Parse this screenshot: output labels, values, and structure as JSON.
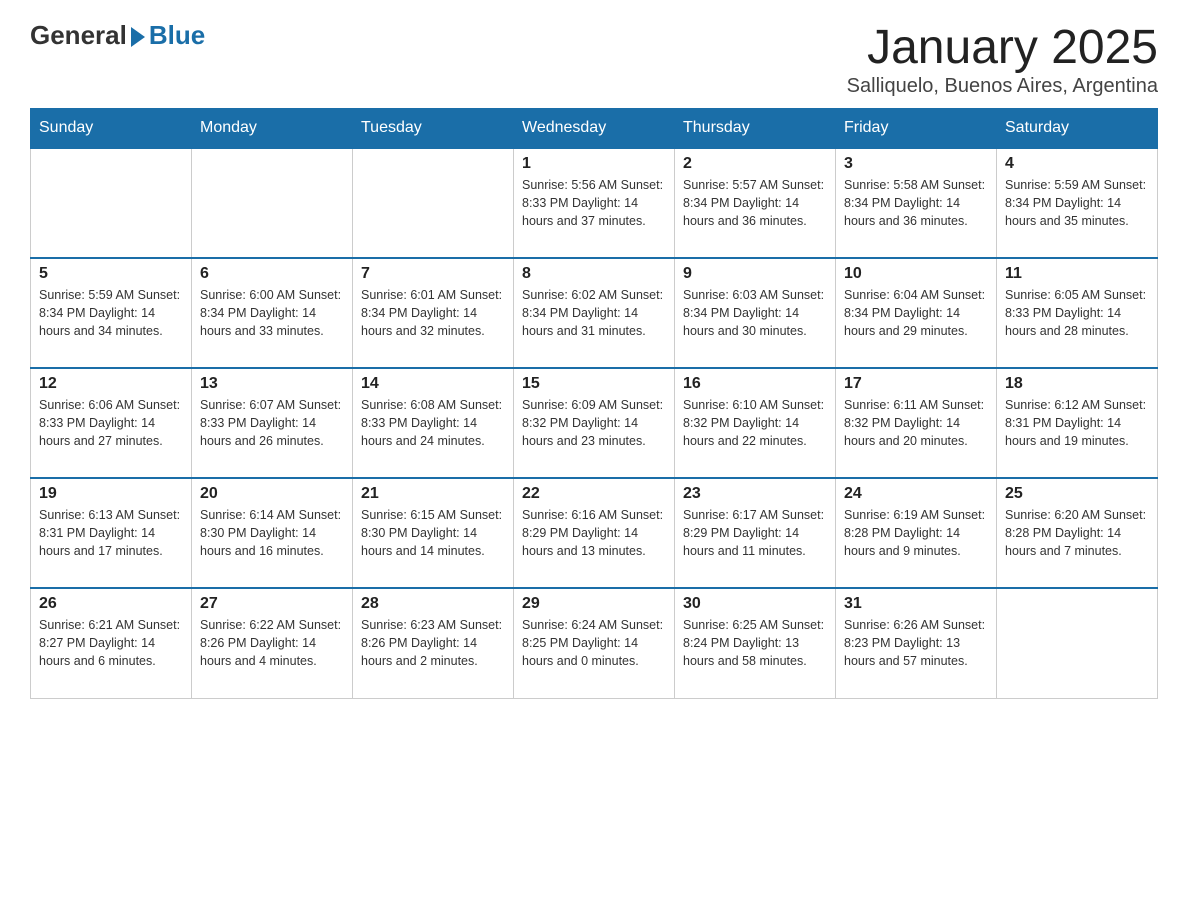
{
  "header": {
    "logo_general": "General",
    "logo_blue": "Blue",
    "title": "January 2025",
    "subtitle": "Salliquelo, Buenos Aires, Argentina"
  },
  "days_of_week": [
    "Sunday",
    "Monday",
    "Tuesday",
    "Wednesday",
    "Thursday",
    "Friday",
    "Saturday"
  ],
  "weeks": [
    [
      {
        "day": "",
        "info": ""
      },
      {
        "day": "",
        "info": ""
      },
      {
        "day": "",
        "info": ""
      },
      {
        "day": "1",
        "info": "Sunrise: 5:56 AM\nSunset: 8:33 PM\nDaylight: 14 hours and 37 minutes."
      },
      {
        "day": "2",
        "info": "Sunrise: 5:57 AM\nSunset: 8:34 PM\nDaylight: 14 hours and 36 minutes."
      },
      {
        "day": "3",
        "info": "Sunrise: 5:58 AM\nSunset: 8:34 PM\nDaylight: 14 hours and 36 minutes."
      },
      {
        "day": "4",
        "info": "Sunrise: 5:59 AM\nSunset: 8:34 PM\nDaylight: 14 hours and 35 minutes."
      }
    ],
    [
      {
        "day": "5",
        "info": "Sunrise: 5:59 AM\nSunset: 8:34 PM\nDaylight: 14 hours and 34 minutes."
      },
      {
        "day": "6",
        "info": "Sunrise: 6:00 AM\nSunset: 8:34 PM\nDaylight: 14 hours and 33 minutes."
      },
      {
        "day": "7",
        "info": "Sunrise: 6:01 AM\nSunset: 8:34 PM\nDaylight: 14 hours and 32 minutes."
      },
      {
        "day": "8",
        "info": "Sunrise: 6:02 AM\nSunset: 8:34 PM\nDaylight: 14 hours and 31 minutes."
      },
      {
        "day": "9",
        "info": "Sunrise: 6:03 AM\nSunset: 8:34 PM\nDaylight: 14 hours and 30 minutes."
      },
      {
        "day": "10",
        "info": "Sunrise: 6:04 AM\nSunset: 8:34 PM\nDaylight: 14 hours and 29 minutes."
      },
      {
        "day": "11",
        "info": "Sunrise: 6:05 AM\nSunset: 8:33 PM\nDaylight: 14 hours and 28 minutes."
      }
    ],
    [
      {
        "day": "12",
        "info": "Sunrise: 6:06 AM\nSunset: 8:33 PM\nDaylight: 14 hours and 27 minutes."
      },
      {
        "day": "13",
        "info": "Sunrise: 6:07 AM\nSunset: 8:33 PM\nDaylight: 14 hours and 26 minutes."
      },
      {
        "day": "14",
        "info": "Sunrise: 6:08 AM\nSunset: 8:33 PM\nDaylight: 14 hours and 24 minutes."
      },
      {
        "day": "15",
        "info": "Sunrise: 6:09 AM\nSunset: 8:32 PM\nDaylight: 14 hours and 23 minutes."
      },
      {
        "day": "16",
        "info": "Sunrise: 6:10 AM\nSunset: 8:32 PM\nDaylight: 14 hours and 22 minutes."
      },
      {
        "day": "17",
        "info": "Sunrise: 6:11 AM\nSunset: 8:32 PM\nDaylight: 14 hours and 20 minutes."
      },
      {
        "day": "18",
        "info": "Sunrise: 6:12 AM\nSunset: 8:31 PM\nDaylight: 14 hours and 19 minutes."
      }
    ],
    [
      {
        "day": "19",
        "info": "Sunrise: 6:13 AM\nSunset: 8:31 PM\nDaylight: 14 hours and 17 minutes."
      },
      {
        "day": "20",
        "info": "Sunrise: 6:14 AM\nSunset: 8:30 PM\nDaylight: 14 hours and 16 minutes."
      },
      {
        "day": "21",
        "info": "Sunrise: 6:15 AM\nSunset: 8:30 PM\nDaylight: 14 hours and 14 minutes."
      },
      {
        "day": "22",
        "info": "Sunrise: 6:16 AM\nSunset: 8:29 PM\nDaylight: 14 hours and 13 minutes."
      },
      {
        "day": "23",
        "info": "Sunrise: 6:17 AM\nSunset: 8:29 PM\nDaylight: 14 hours and 11 minutes."
      },
      {
        "day": "24",
        "info": "Sunrise: 6:19 AM\nSunset: 8:28 PM\nDaylight: 14 hours and 9 minutes."
      },
      {
        "day": "25",
        "info": "Sunrise: 6:20 AM\nSunset: 8:28 PM\nDaylight: 14 hours and 7 minutes."
      }
    ],
    [
      {
        "day": "26",
        "info": "Sunrise: 6:21 AM\nSunset: 8:27 PM\nDaylight: 14 hours and 6 minutes."
      },
      {
        "day": "27",
        "info": "Sunrise: 6:22 AM\nSunset: 8:26 PM\nDaylight: 14 hours and 4 minutes."
      },
      {
        "day": "28",
        "info": "Sunrise: 6:23 AM\nSunset: 8:26 PM\nDaylight: 14 hours and 2 minutes."
      },
      {
        "day": "29",
        "info": "Sunrise: 6:24 AM\nSunset: 8:25 PM\nDaylight: 14 hours and 0 minutes."
      },
      {
        "day": "30",
        "info": "Sunrise: 6:25 AM\nSunset: 8:24 PM\nDaylight: 13 hours and 58 minutes."
      },
      {
        "day": "31",
        "info": "Sunrise: 6:26 AM\nSunset: 8:23 PM\nDaylight: 13 hours and 57 minutes."
      },
      {
        "day": "",
        "info": ""
      }
    ]
  ]
}
